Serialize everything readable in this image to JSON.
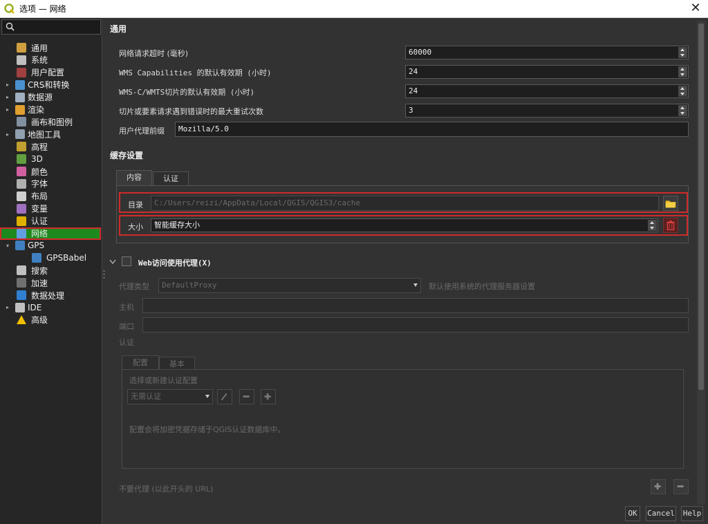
{
  "window": {
    "title": "选项 — 网络"
  },
  "sidebar": {
    "search_placeholder": "",
    "items": [
      {
        "label": "通用",
        "icon": "wrench-icon",
        "level": 1
      },
      {
        "label": "系统",
        "icon": "gear-icon",
        "level": 1
      },
      {
        "label": "用户配置",
        "icon": "user-icon",
        "level": 1
      },
      {
        "label": "CRS和转换",
        "icon": "crs-icon",
        "level": 0,
        "arrow": "▸"
      },
      {
        "label": "数据源",
        "icon": "table-icon",
        "level": 0,
        "arrow": "▸"
      },
      {
        "label": "渲染",
        "icon": "brush-icon",
        "level": 0,
        "arrow": "▸"
      },
      {
        "label": "画布和图例",
        "icon": "canvas-icon",
        "level": 1
      },
      {
        "label": "地图工具",
        "icon": "map-tools-icon",
        "level": 0,
        "arrow": "▸"
      },
      {
        "label": "高程",
        "icon": "elevation-icon",
        "level": 1
      },
      {
        "label": "3D",
        "icon": "cube-icon",
        "level": 1
      },
      {
        "label": "颜色",
        "icon": "palette-icon",
        "level": 1
      },
      {
        "label": "字体",
        "icon": "font-icon",
        "level": 1
      },
      {
        "label": "布局",
        "icon": "layout-icon",
        "level": 1
      },
      {
        "label": "变量",
        "icon": "variable-icon",
        "level": 1
      },
      {
        "label": "认证",
        "icon": "lock-icon",
        "level": 1
      },
      {
        "label": "网络",
        "icon": "network-icon",
        "level": 1,
        "selected": true
      },
      {
        "label": "GPS",
        "icon": "gps-icon",
        "level": 0,
        "arrow": "▾"
      },
      {
        "label": "GPSBabel",
        "icon": "gpsbabel-icon",
        "level": 2
      },
      {
        "label": "搜索",
        "icon": "search-icon",
        "level": 1
      },
      {
        "label": "加速",
        "icon": "accelerate-icon",
        "level": 1
      },
      {
        "label": "数据处理",
        "icon": "processing-icon",
        "level": 1
      },
      {
        "label": "IDE",
        "icon": "ide-icon",
        "level": 0,
        "arrow": "▸"
      },
      {
        "label": "高级",
        "icon": "warning-icon",
        "level": 1
      }
    ]
  },
  "general": {
    "title": "通用",
    "timeout_label": "网络请求超时 (毫秒)",
    "timeout_value": "60000",
    "wms_cap_label": "WMS Capabilities 的默认有效期 (小时)",
    "wms_cap_value": "24",
    "wmts_label": "WMS-C/WMTS切片的默认有效期 (小时)",
    "wmts_value": "24",
    "retry_label": "切片或要素请求遇到错误时的最大重试次数",
    "retry_value": "3",
    "useragent_label": "用户代理前缀",
    "useragent_value": "Mozilla/5.0"
  },
  "cache": {
    "title": "缓存设置",
    "tab_content": "内容",
    "tab_auth": "认证",
    "dir_label": "目录",
    "dir_value": "C:/Users/reizi/AppData/Local/QGIS/QGIS3/cache",
    "size_label": "大小",
    "size_value": "智能缓存大小"
  },
  "proxy": {
    "checkbox_label": "Web访问使用代理(X)",
    "type_label": "代理类型",
    "type_value": "DefaultProxy",
    "type_desc": "默认使用系统的代理服务器设置",
    "host_label": "主机",
    "port_label": "端口",
    "auth_label": "认证",
    "tab_config": "配置",
    "tab_basic": "基本",
    "choose_config": "选择或新建认证配置",
    "no_auth": "无需认证",
    "encrypt_note": "配置会将加密凭据存储于QGIS认证数据库中。",
    "no_proxy_label": "不要代理 (以此开头的 URL)"
  },
  "buttons": {
    "ok": "OK",
    "cancel": "Cancel",
    "help": "Help"
  }
}
